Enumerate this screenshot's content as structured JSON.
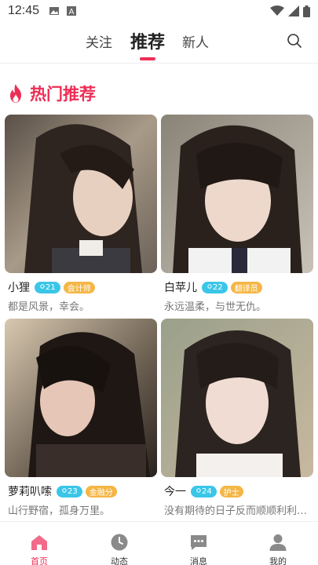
{
  "status_bar": {
    "time": "12:45"
  },
  "top_nav": {
    "tabs": [
      "关注",
      "推荐",
      "新人"
    ],
    "active_tab": "推荐"
  },
  "section": {
    "title": "热门推荐",
    "accent": "#ee2d55"
  },
  "cards": [
    {
      "name": "小狸",
      "age": "21",
      "job": "会计师",
      "signature": "都是风景，幸会。"
    },
    {
      "name": "白苹儿",
      "age": "22",
      "job": "翻译员",
      "signature": "永远温柔，与世无仇。"
    },
    {
      "name": "萝莉叭嗦",
      "age": "23",
      "job": "金融分",
      "signature": "山行野宿，孤身万里。"
    },
    {
      "name": "今一",
      "age": "24",
      "job": "护士",
      "signature": "没有期待的日子反而顺顺利利…"
    }
  ],
  "bottom_nav": {
    "items": [
      "首页",
      "动态",
      "消息",
      "我的"
    ],
    "active": "首页"
  },
  "colors": {
    "accent": "#ee2d55",
    "age_badge": "#3bc6e8",
    "job_badge": "#f5b646"
  }
}
